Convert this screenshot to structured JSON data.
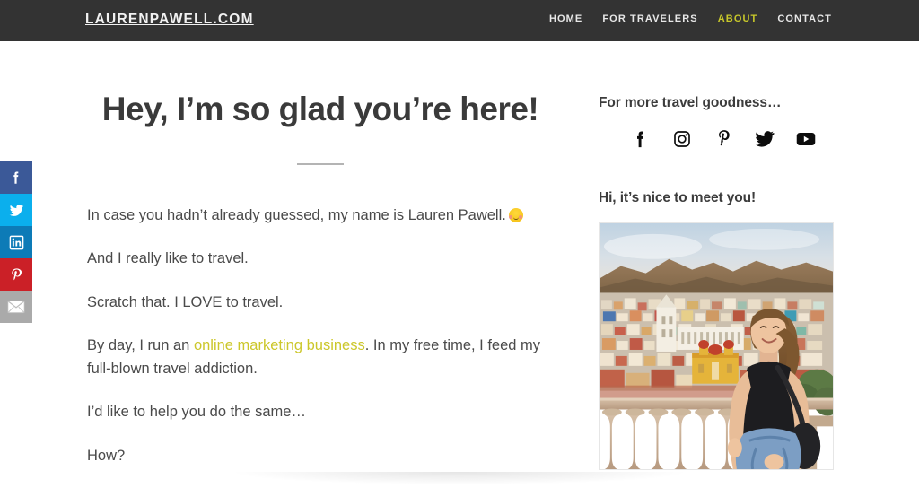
{
  "header": {
    "brand": "LAURENPAWELL.COM",
    "nav": [
      {
        "label": "HOME",
        "active": false
      },
      {
        "label": "FOR TRAVELERS",
        "active": false
      },
      {
        "label": "ABOUT",
        "active": true
      },
      {
        "label": "CONTACT",
        "active": false
      }
    ],
    "background_color": "#333333",
    "accent_color": "#c8c82a"
  },
  "share_rail": {
    "items": [
      {
        "name": "facebook",
        "label": "Share on Facebook",
        "color": "#3b5998"
      },
      {
        "name": "twitter",
        "label": "Share on Twitter",
        "color": "#0bafed"
      },
      {
        "name": "linkedin",
        "label": "Share on LinkedIn",
        "color": "#0d7bb7"
      },
      {
        "name": "pinterest",
        "label": "Save to Pinterest",
        "color": "#cb2027"
      },
      {
        "name": "email",
        "label": "Share by Email",
        "color": "#aaaaaa"
      }
    ]
  },
  "main": {
    "title": "Hey, I’m so glad you’re here!",
    "paragraphs": [
      {
        "id": "p1",
        "text_before": "In case you hadn’t already guessed, my name is Lauren Pawell.",
        "emoji": "relieved-face",
        "text_after": ""
      },
      {
        "id": "p2",
        "text_before": "And I really like to travel.",
        "emoji": null,
        "text_after": ""
      },
      {
        "id": "p3",
        "text_before": "Scratch that. I LOVE to travel.",
        "emoji": null,
        "text_after": ""
      },
      {
        "id": "p4",
        "text_before": "By day, I run an ",
        "link": "online marketing business",
        "text_after": ". In my free time, I feed my full-blown travel addiction."
      },
      {
        "id": "p5",
        "text_before": "I’d like to help you do the same…",
        "emoji": null,
        "text_after": ""
      },
      {
        "id": "p6",
        "text_before": "How?",
        "emoji": null,
        "text_after": ""
      }
    ],
    "link_color": "#ccc72b"
  },
  "sidebar": {
    "social_widget_title": "For more travel goodness…",
    "social_links": [
      {
        "name": "facebook-icon",
        "label": "Facebook"
      },
      {
        "name": "instagram-icon",
        "label": "Instagram"
      },
      {
        "name": "pinterest-icon",
        "label": "Pinterest"
      },
      {
        "name": "twitter-icon",
        "label": "Twitter"
      },
      {
        "name": "youtube-icon",
        "label": "YouTube"
      }
    ],
    "bio_widget_title": "Hi, it’s nice to meet you!",
    "bio_photo_alt": "Lauren standing at a stone balustrade overlooking a colorful hillside city"
  }
}
